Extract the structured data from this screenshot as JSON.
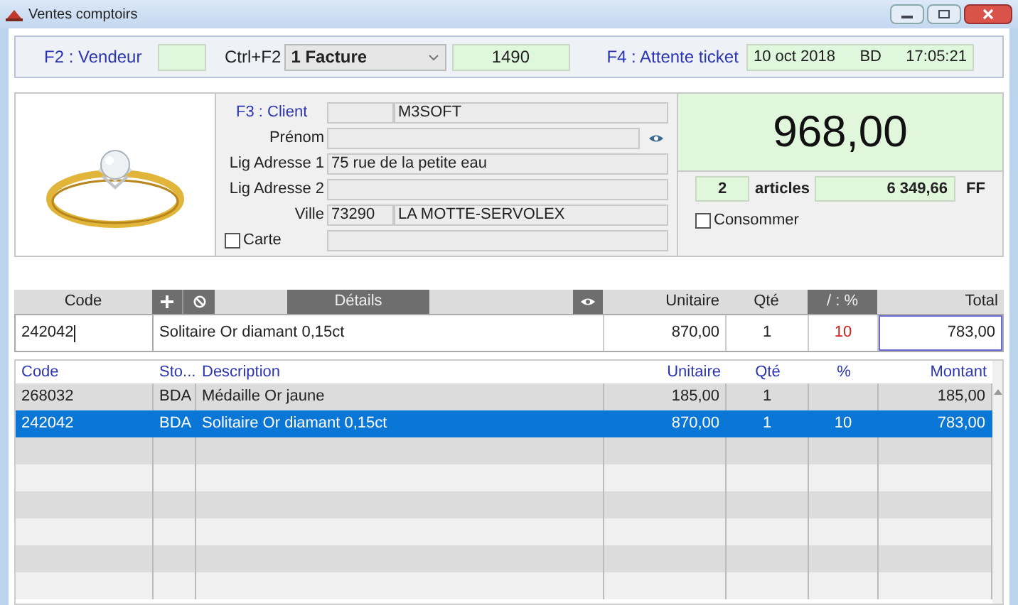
{
  "window": {
    "title": "Ventes comptoirs"
  },
  "top_bar": {
    "vendeur_label": "F2 : Vendeur",
    "shortcut": "Ctrl+F2",
    "document_type": "1 Facture",
    "number": "1490",
    "hold_label": "F4 : Attente ticket",
    "date": "10 oct 2018",
    "user": "BD",
    "time": "17:05:21"
  },
  "client": {
    "client_label": "F3 : Client",
    "client_name": "M3SOFT",
    "first_name_label": "Prénom",
    "address1_label": "Lig Adresse 1",
    "address1": "75 rue de la petite eau",
    "address2_label": "Lig Adresse 2",
    "city_label": "Ville",
    "postcode": "73290",
    "city": "LA MOTTE-SERVOLEX",
    "card": {
      "label": "Carte",
      "checked": false
    }
  },
  "totals": {
    "total": "968,00",
    "count": "2",
    "count_label": "articles",
    "other_total": "6 349,66",
    "currency": "FF",
    "consume": {
      "label": "Consommer",
      "checked": false
    }
  },
  "entry": {
    "headers": {
      "code": "Code",
      "details": "Détails",
      "unit": "Unitaire",
      "qty": "Qté",
      "discount": "/ : %",
      "total": "Total"
    },
    "code": "242042",
    "description": "Solitaire Or diamant 0,15ct",
    "unit": "870,00",
    "qty": "1",
    "discount": "10",
    "total": "783,00"
  },
  "table": {
    "columns": [
      "Code",
      "Sto...",
      "Description",
      "Unitaire",
      "Qté",
      "%",
      "Montant"
    ],
    "rows": [
      {
        "cells": [
          "268032",
          "BDA",
          "Médaille Or jaune",
          "185,00",
          "1",
          "",
          "185,00"
        ],
        "selected": false
      },
      {
        "cells": [
          "242042",
          "BDA",
          "Solitaire Or diamant 0,15ct",
          "870,00",
          "1",
          "10",
          "783,00"
        ],
        "selected": true
      }
    ]
  }
}
